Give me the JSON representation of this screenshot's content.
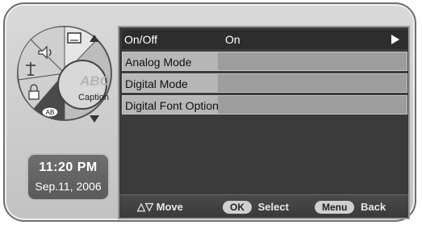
{
  "clock": {
    "time": "11:20 PM",
    "date": "Sep.11, 2006"
  },
  "dial": {
    "center_label": "Caption",
    "center_art": "ABC",
    "items": [
      {
        "icon": "display-icon"
      },
      {
        "icon": "speaker-icon"
      },
      {
        "icon": "antenna-icon"
      },
      {
        "icon": "lock-icon"
      },
      {
        "icon": "ab-icon",
        "label": "AB"
      }
    ]
  },
  "menu": {
    "rows": [
      {
        "label": "On/Off",
        "value": "On",
        "selected": true
      },
      {
        "label": "Analog Mode",
        "value": ""
      },
      {
        "label": "Digital Mode",
        "value": ""
      },
      {
        "label": "Digital Font Option",
        "value": ""
      }
    ]
  },
  "footer": {
    "move_label": "Move",
    "move_symbols": "△▽",
    "ok_key": "OK",
    "select_label": "Select",
    "menu_key": "Menu",
    "back_label": "Back"
  }
}
